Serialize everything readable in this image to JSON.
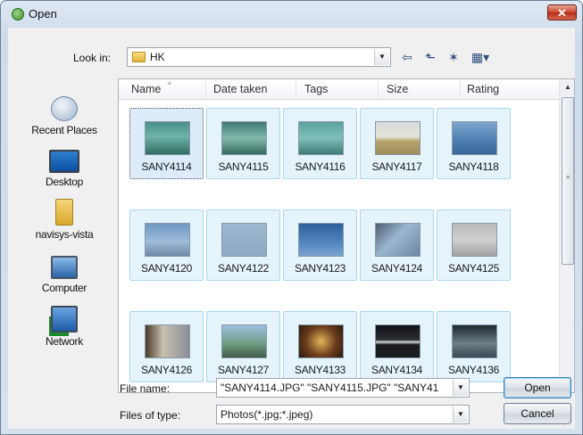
{
  "window": {
    "title": "Open",
    "close_glyph": "✕"
  },
  "toolbar": {
    "look_in_label": "Look in:",
    "look_in_value": "HK",
    "buttons": [
      {
        "name": "back-icon",
        "glyph": "⇦"
      },
      {
        "name": "up-folder-icon",
        "glyph": "⬑"
      },
      {
        "name": "new-folder-icon",
        "glyph": "✶"
      },
      {
        "name": "views-menu-icon",
        "glyph": "▦▾"
      }
    ]
  },
  "places": [
    {
      "label": "Recent Places",
      "icon": "recent-places-icon"
    },
    {
      "label": "Desktop",
      "icon": "desktop-icon"
    },
    {
      "label": "navisys-vista",
      "icon": "user-folder-icon"
    },
    {
      "label": "Computer",
      "icon": "computer-icon"
    },
    {
      "label": "Network",
      "icon": "network-icon"
    }
  ],
  "columns": [
    "Name",
    "Date taken",
    "Tags",
    "Size",
    "Rating"
  ],
  "files": [
    {
      "name": "SANY4114",
      "thumb": "linear-gradient(#4a8f86,#6fb3a8 45%,#2f6e63)"
    },
    {
      "name": "SANY4115",
      "thumb": "linear-gradient(#3f7c72,#83b9ad 50%,#356b5f)"
    },
    {
      "name": "SANY4116",
      "thumb": "linear-gradient(#5aa3a0,#7fc0bb 50%,#3c7b76)"
    },
    {
      "name": "SANY4117",
      "thumb": "linear-gradient(#d9dcdd,#e6e4da 45%,#b5a46a 60%,#9d8c58)"
    },
    {
      "name": "SANY4118",
      "thumb": "linear-gradient(#7ea5cc,#4f80b4 55%,#3a6898)"
    },
    {
      "name": "SANY4120",
      "thumb": "linear-gradient(#6f98c3,#9fbcd8 55%,#6f8aa6)"
    },
    {
      "name": "SANY4122",
      "thumb": "linear-gradient(#9eb7cf,#8caac6)"
    },
    {
      "name": "SANY4123",
      "thumb": "linear-gradient(#2d5f9c,#5486c0 60%,#7aa3cf)"
    },
    {
      "name": "SANY4124",
      "thumb": "linear-gradient(135deg,#4d5f73,#9bb6d0 45%,#6c87a3)"
    },
    {
      "name": "SANY4125",
      "thumb": "linear-gradient(#b9b9b9,#d0d0d0 50%,#a0a0a0)"
    },
    {
      "name": "SANY4126",
      "thumb": "linear-gradient(90deg,#4a3a26,#c8c0b0 40%,#8a8f96)"
    },
    {
      "name": "SANY4127",
      "thumb": "linear-gradient(#9ec0de,#6c9a7e 60%,#3f5d49)"
    },
    {
      "name": "SANY4133",
      "thumb": "radial-gradient(circle,#e1b45a,#6b3d1c 55%,#2b1a10)"
    },
    {
      "name": "SANY4134",
      "thumb": "linear-gradient(#101215,#2a2e33 45%,#d8d8d8 52%,#1a1c1f 60%)"
    },
    {
      "name": "SANY4136",
      "thumb": "linear-gradient(#1d2730,#6e7e86 55%,#3b4a52)"
    }
  ],
  "file_name": {
    "label": "File name:",
    "value": "\"SANY4114.JPG\" \"SANY4115.JPG\" \"SANY41"
  },
  "file_type": {
    "label": "Files of type:",
    "value": "Photos(*.jpg;*.jpeg)"
  },
  "buttons": {
    "open": "Open",
    "cancel": "Cancel"
  }
}
